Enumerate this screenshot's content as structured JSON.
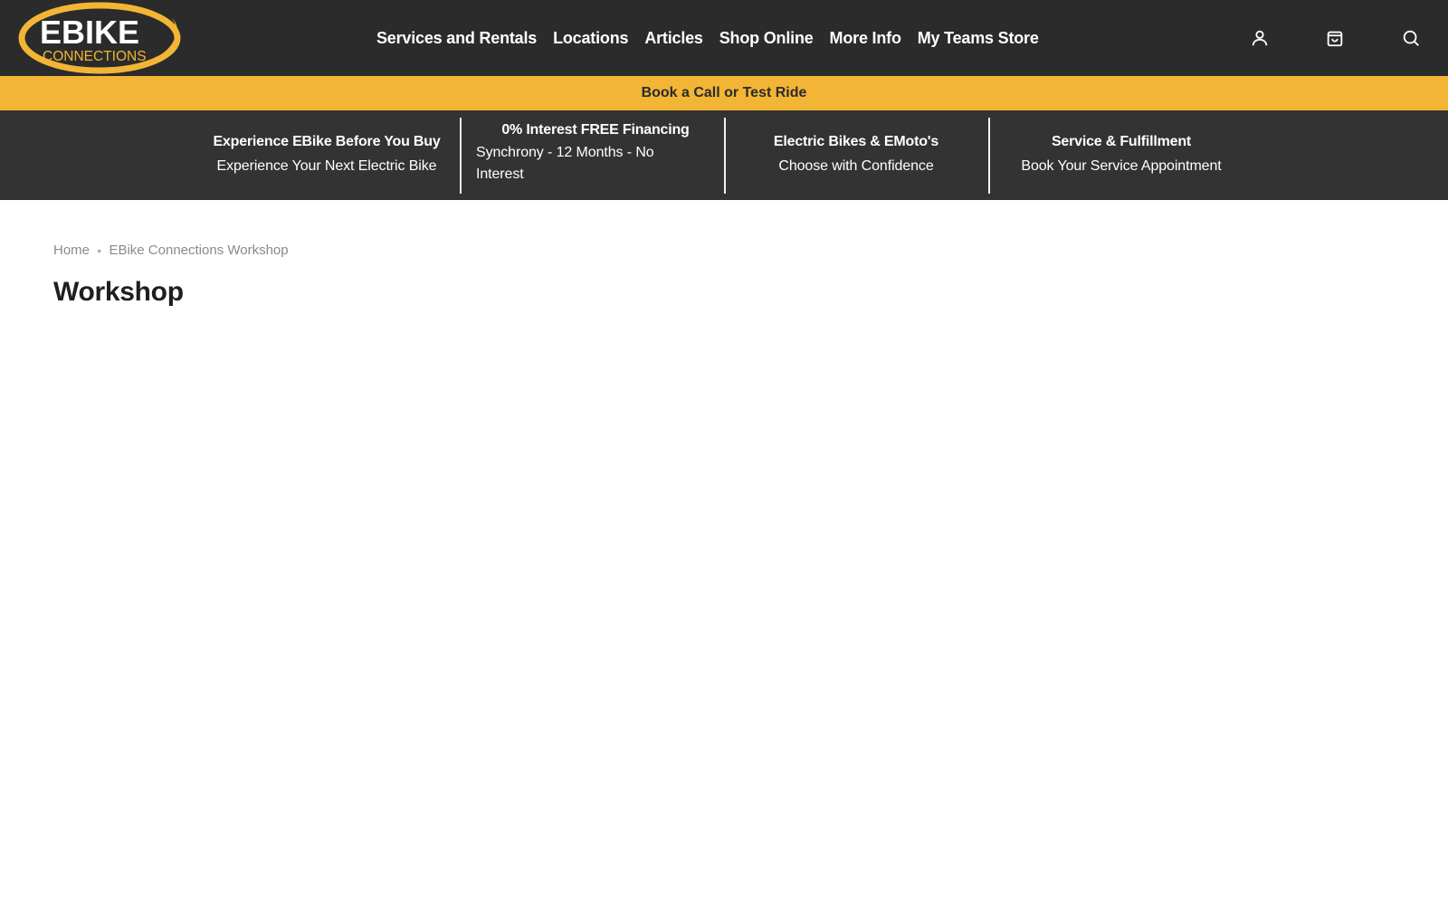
{
  "logo": {
    "word1": "EBIKE",
    "word2": "CONNECTIONS"
  },
  "nav": {
    "items": [
      "Services and Rentals",
      "Locations",
      "Articles",
      "Shop Online",
      "More Info",
      "My Teams Store"
    ]
  },
  "icons": {
    "account": "user-icon",
    "cart": "shopping-bag-icon",
    "search": "search-icon"
  },
  "announcement": {
    "label": "Book a Call or Test Ride"
  },
  "promos": [
    {
      "title": "Experience EBike Before You Buy",
      "subtitle": "Experience Your Next Electric Bike"
    },
    {
      "title": "0% Interest FREE Financing",
      "subtitle": "Synchrony - 12 Months - No Interest"
    },
    {
      "title": "Electric Bikes & EMoto's",
      "subtitle": "Choose with Confidence"
    },
    {
      "title": "Service & Fulfillment",
      "subtitle": "Book Your Service Appointment"
    }
  ],
  "breadcrumb": {
    "home": "Home",
    "current": "EBike Connections Workshop"
  },
  "page": {
    "title": "Workshop"
  },
  "colors": {
    "header_bg": "#2b2b2b",
    "accent": "#f2b535",
    "promo_bg": "#333333"
  }
}
